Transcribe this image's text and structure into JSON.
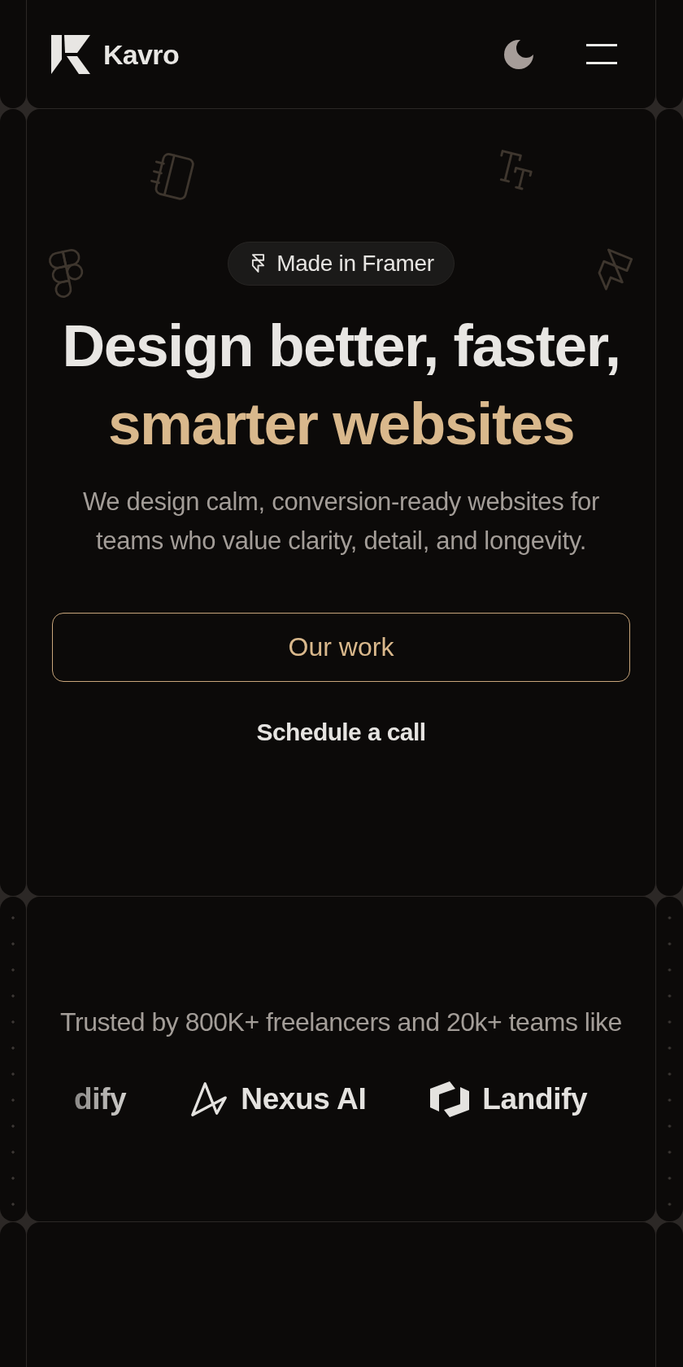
{
  "header": {
    "brand": "Kavro"
  },
  "hero": {
    "badge": "Made in Framer",
    "heading": {
      "text": "Design better, faster,",
      "highlight": "smarter websites"
    },
    "subheading": "We design calm, conversion-ready websites for teams who value clarity, detail, and longevity.",
    "buttons": [
      {
        "label": "Our work",
        "kind": "outline"
      },
      {
        "label": "Schedule a call",
        "kind": "plain"
      }
    ]
  },
  "trusted": {
    "caption": "Trusted by 800K+ freelancers and 20k+ teams like",
    "logos": [
      {
        "name": "dify",
        "kind": "wordmark"
      },
      {
        "name": "Nexus AI",
        "kind": "peak"
      },
      {
        "name": "Landify",
        "kind": "cube"
      }
    ]
  }
}
